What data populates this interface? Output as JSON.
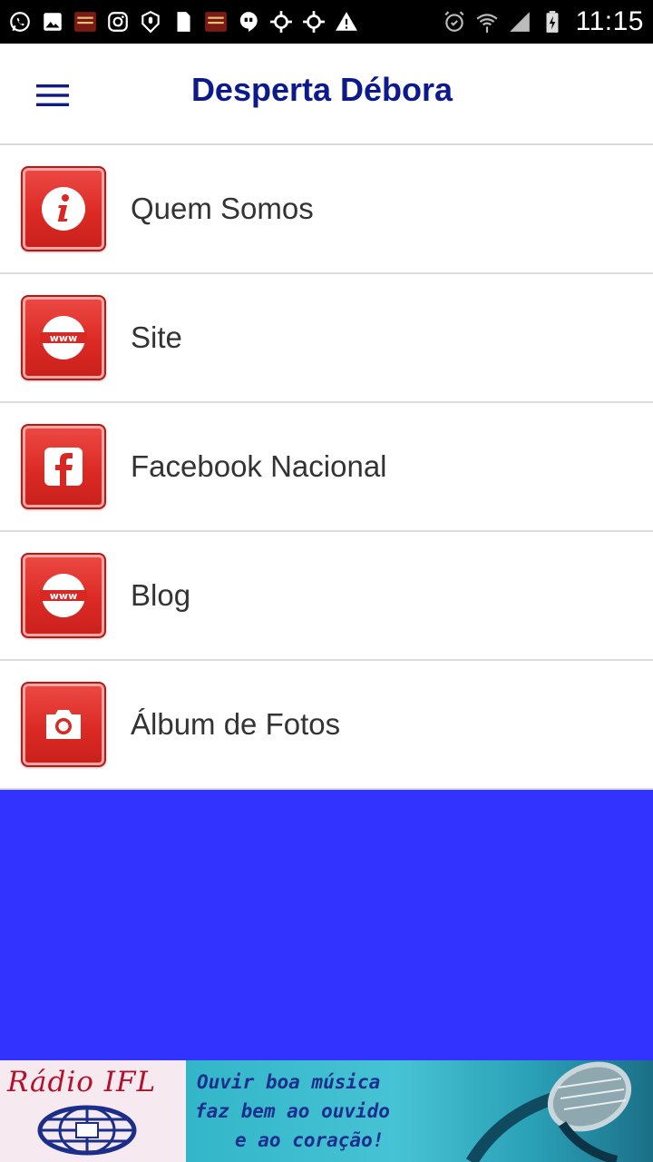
{
  "status_bar": {
    "time": "11:15",
    "left_icons": [
      "whatsapp-icon",
      "image-icon",
      "app-thumbnail-icon",
      "instagram-icon",
      "podcast-icon",
      "sim-card-icon",
      "app-thumbnail-icon",
      "hangouts-icon",
      "location-icon",
      "location-icon",
      "warning-icon"
    ],
    "right_icons": [
      "alarm-icon",
      "wifi-icon",
      "signal-icon",
      "battery-charging-icon"
    ]
  },
  "app_bar": {
    "title": "Desperta Débora",
    "title_color": "#0d1a8c"
  },
  "menu": {
    "items": [
      {
        "label": "Quem Somos",
        "icon": "info-icon"
      },
      {
        "label": "Site",
        "icon": "www-icon"
      },
      {
        "label": "Facebook Nacional",
        "icon": "facebook-icon"
      },
      {
        "label": "Blog",
        "icon": "www-icon"
      },
      {
        "label": "Álbum de Fotos",
        "icon": "camera-icon"
      }
    ],
    "icon_color": "#dc2a25"
  },
  "content_area": {
    "background": "#3333ff"
  },
  "banner": {
    "brand": "Rádio IFL",
    "slogan_lines": [
      "Ouvir boa música",
      "faz bem ao ouvido",
      "e ao coração!"
    ]
  }
}
